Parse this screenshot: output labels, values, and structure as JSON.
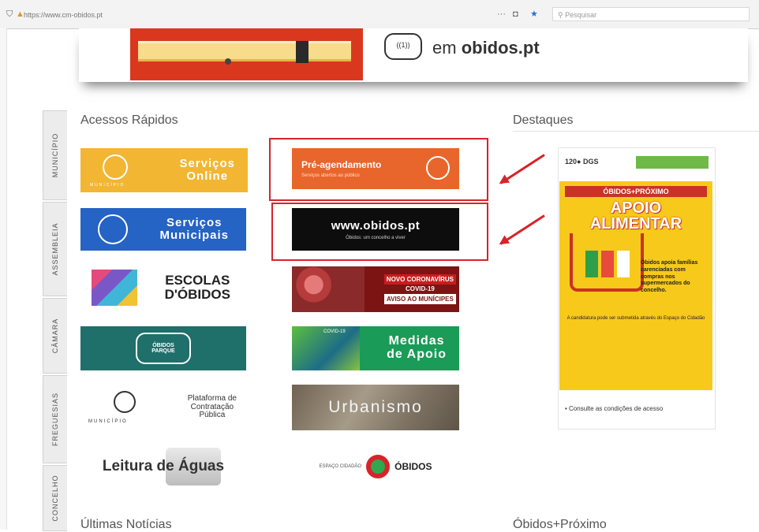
{
  "browser": {
    "url": "https://www.cm-obidos.pt",
    "search_placeholder": "Pesquisar"
  },
  "hero": {
    "logo_text": "((1))",
    "text_prefix": "em ",
    "text_bold": "obidos.pt"
  },
  "side_tabs": [
    "MUNICÍPIO",
    "ASSEMBLEIA",
    "CÂMARA",
    "FREGUESIAS",
    "CONCELHO"
  ],
  "quick_access": {
    "title": "Acessos Rápidos",
    "tiles": {
      "servicos_online": {
        "line1": "Serviços",
        "line2": "Online",
        "caption": "MUNICÍPIO"
      },
      "pre_agendamento": {
        "title": "Pré-agendamento",
        "subtitle": "Serviços abertos ao público"
      },
      "servicos_municipais": {
        "line1": "Serviços",
        "line2": "Municipais"
      },
      "obidos_pt": {
        "title": "www.obidos.pt",
        "subtitle": "Óbidos: um concelho a viver"
      },
      "escolas": {
        "line1": "ESCOLAS",
        "line2": "D'ÓBIDOS"
      },
      "covid": {
        "line1": "NOVO CORONAVÍRUS",
        "line2": "COVID-19",
        "line3": "AVISO AO MUNÍCIPES"
      },
      "obidos_parque": {
        "line1": "ÓBIDOS",
        "line2": "PARQUE"
      },
      "medidas": {
        "line1": "Medidas",
        "line2": "de Apoio",
        "tag": "COVID-19"
      },
      "plataforma": {
        "line1": "Plataforma de",
        "line2": "Contratação",
        "line3": "Pública",
        "caption": "MUNICÍPIO"
      },
      "urbanismo": {
        "title": "Urbanismo"
      },
      "leitura": {
        "title": "Leitura de Águas"
      },
      "espaco_cidadao": {
        "left": "ESPAÇO CIDADÃO",
        "right": "ÓBIDOS"
      }
    }
  },
  "highlights": {
    "title": "Destaques",
    "promo": {
      "logos": "120● DGS",
      "banner_top": "ÓBIDOS+PRÓXIMO",
      "headline1": "APOIO",
      "headline2": "ALIMENTAR",
      "side_text": "Óbidos apoia famílias carenciadas com compras nos supermercados do concelho.",
      "footer_text": "A candidatura pode ser submetida através do Espaço do Cidadão",
      "link": "• Consulte as condições de acesso"
    }
  },
  "bottom_titles": {
    "news": "Últimas Notícias",
    "proximo": "Óbidos+Próximo"
  },
  "colors": {
    "highlight_red": "#d8232a",
    "online_yellow": "#f2b632",
    "pre_orange": "#e8652b",
    "municipais_blue": "#2563c4",
    "parque_teal": "#1f6f6a",
    "medidas_green": "#1a9b57",
    "promo_yellow": "#f7c91b"
  }
}
